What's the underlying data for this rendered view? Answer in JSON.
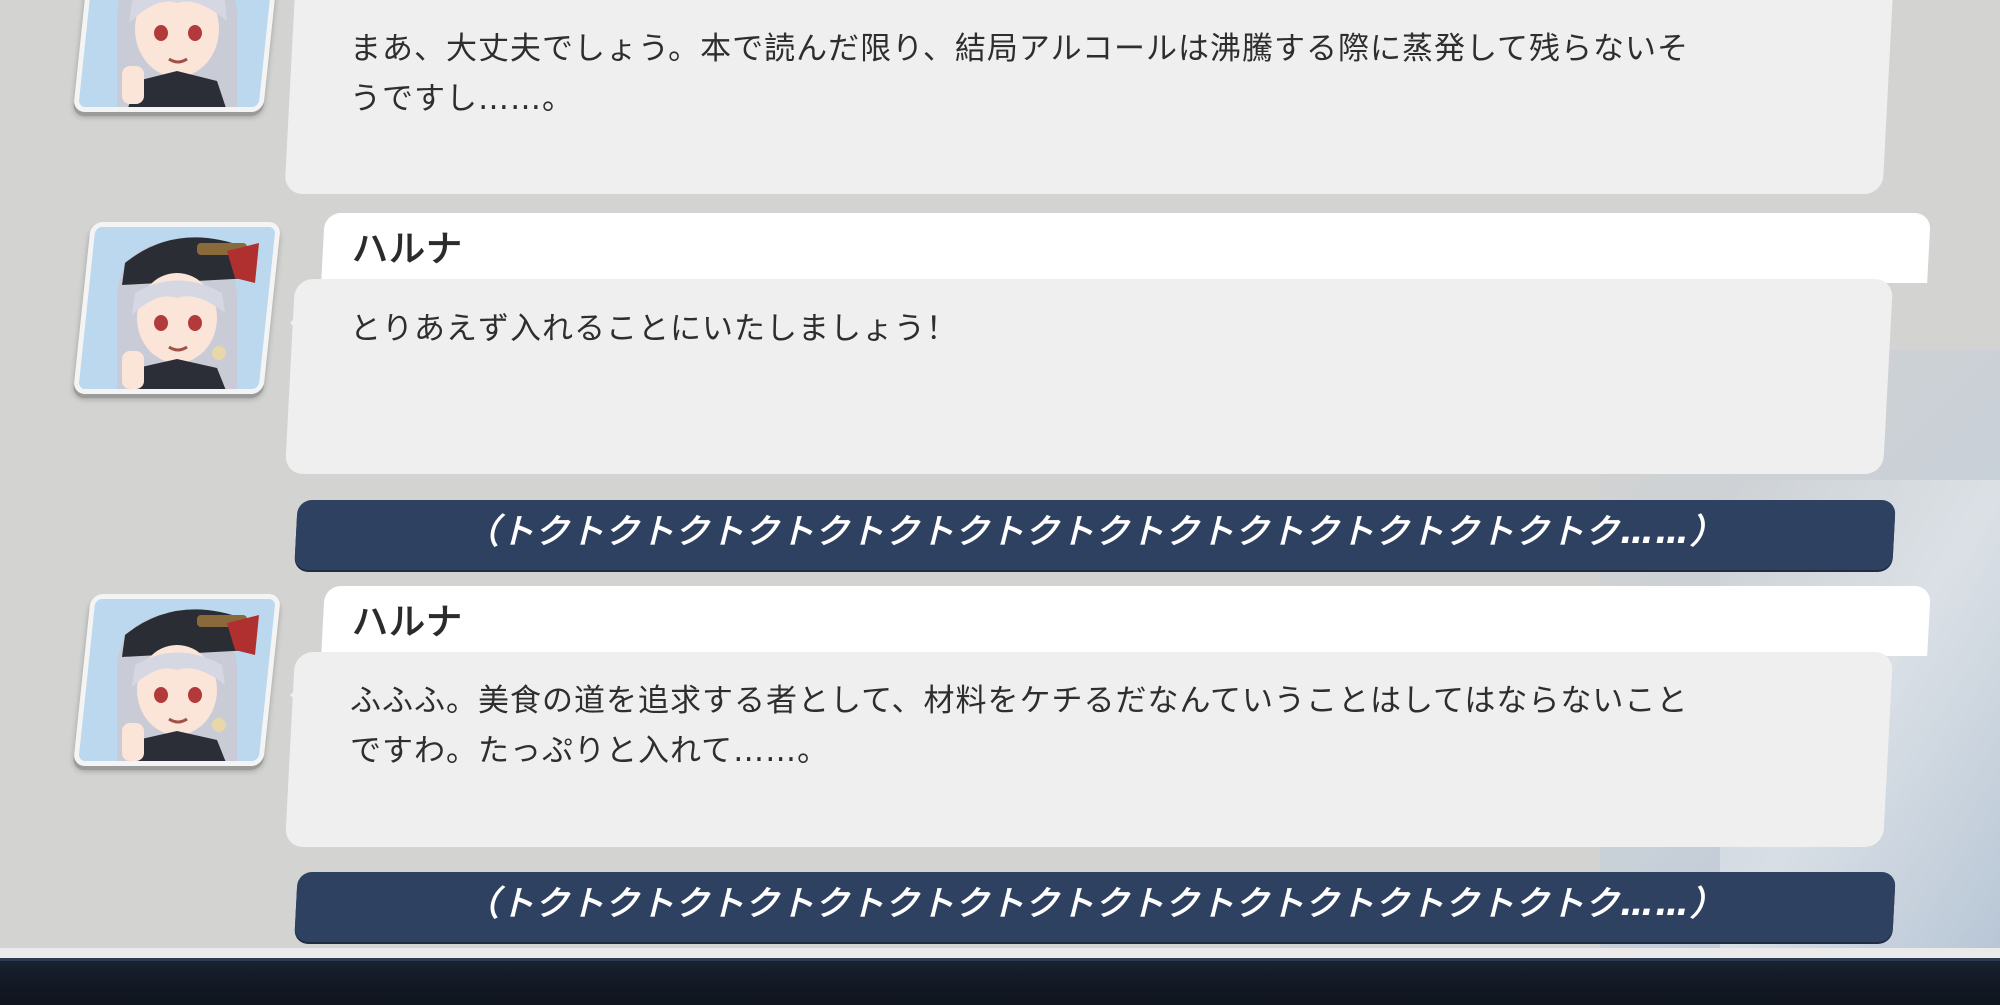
{
  "dialogue_log": [
    {
      "speaker": "",
      "text": "まあ、大丈夫でしょう。本で読んだ限り、結局アルコールは沸騰する際に蒸発して残らないそ\nうですし……。"
    },
    {
      "speaker": "ハルナ",
      "text": "とりあえず入れることにいたしましょう！"
    },
    {
      "sfx": "（トクトクトクトクトクトクトクトクトクトクトクトクトクトクトクトク……）"
    },
    {
      "speaker": "ハルナ",
      "text": "ふふふ。美食の道を追求する者として、材料をケチるだなんていうことはしてはならないこと\nですわ。たっぷりと入れて……。"
    },
    {
      "sfx": "（トクトクトクトクトクトクトクトクトクトクトクトクトクトクトクトク……）"
    }
  ],
  "portrait_icon": "haruna-portrait",
  "colors": {
    "background": "#d3d3d1",
    "bubble": "#efefef",
    "name_plate": "#ffffff",
    "sfx_bar": "#2f4161",
    "sfx_text": "#ffffff"
  }
}
